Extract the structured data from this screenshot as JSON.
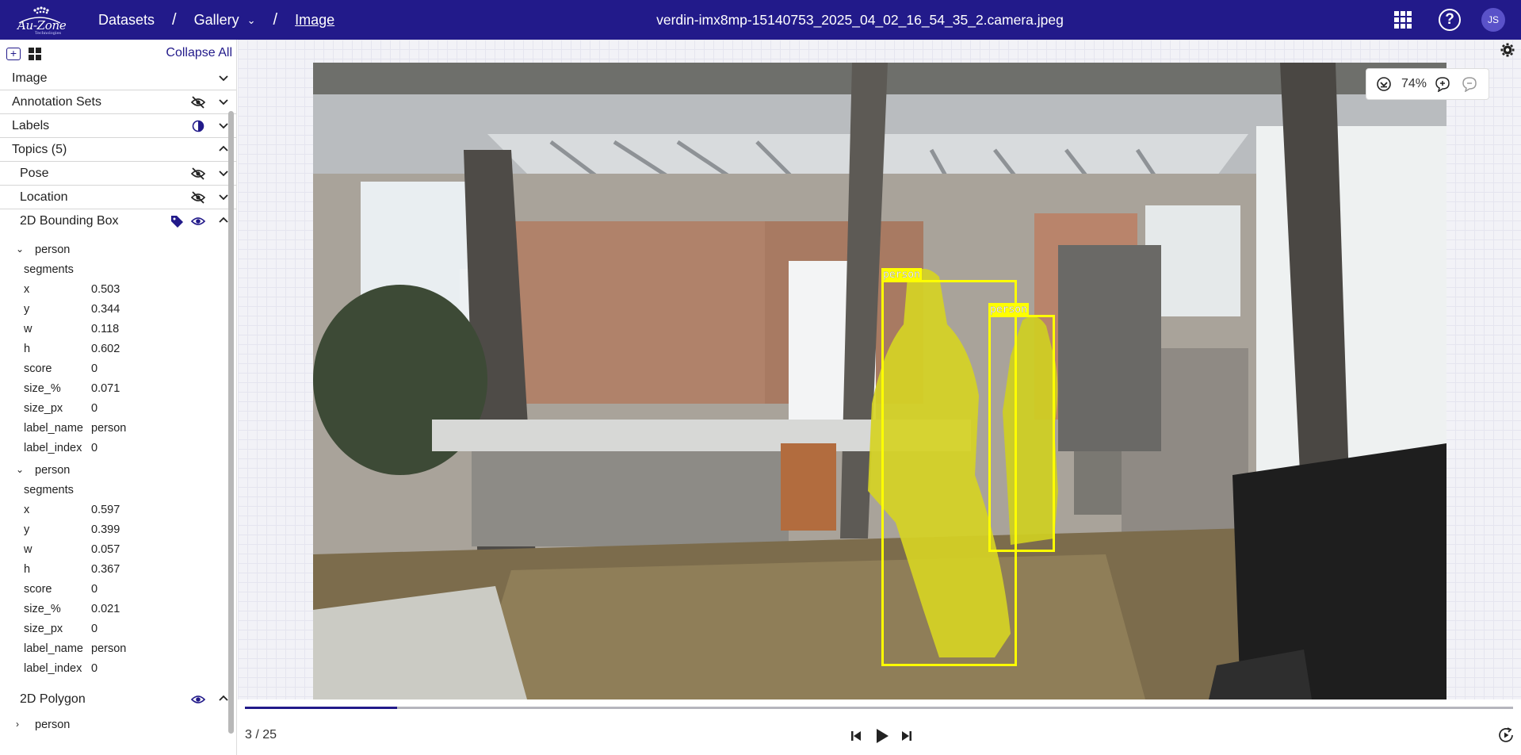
{
  "header": {
    "logo_text": "Au-Zone",
    "logo_sub": "Technologies",
    "crumbs": [
      "Datasets",
      "Gallery",
      "Image"
    ],
    "file_title": "verdin-imx8mp-15140753_2025_04_02_16_54_35_2.camera.jpeg",
    "avatar_initials": "JS",
    "brand_color": "#221a8a"
  },
  "sidebar": {
    "collapse_all": "Collapse All",
    "sections": {
      "image": "Image",
      "annotation_sets": "Annotation Sets",
      "labels": "Labels",
      "topics": "Topics (5)",
      "pose": "Pose",
      "location": "Location",
      "bbox2d": "2D Bounding Box",
      "polygon2d": "2D Polygon"
    },
    "bbox_items": [
      {
        "name": "person",
        "segments_label": "segments",
        "fields": [
          {
            "k": "x",
            "v": "0.503"
          },
          {
            "k": "y",
            "v": "0.344"
          },
          {
            "k": "w",
            "v": "0.118"
          },
          {
            "k": "h",
            "v": "0.602"
          },
          {
            "k": "score",
            "v": "0"
          },
          {
            "k": "size_%",
            "v": "0.071"
          },
          {
            "k": "size_px",
            "v": "0"
          },
          {
            "k": "label_name",
            "v": "person"
          },
          {
            "k": "label_index",
            "v": "0"
          }
        ]
      },
      {
        "name": "person",
        "segments_label": "segments",
        "fields": [
          {
            "k": "x",
            "v": "0.597"
          },
          {
            "k": "y",
            "v": "0.399"
          },
          {
            "k": "w",
            "v": "0.057"
          },
          {
            "k": "h",
            "v": "0.367"
          },
          {
            "k": "score",
            "v": "0"
          },
          {
            "k": "size_%",
            "v": "0.021"
          },
          {
            "k": "size_px",
            "v": "0"
          },
          {
            "k": "label_name",
            "v": "person"
          },
          {
            "k": "label_index",
            "v": "0"
          }
        ]
      }
    ],
    "polygon_items": [
      {
        "name": "person"
      }
    ]
  },
  "viewer": {
    "zoom": "74%",
    "overlay_boxes": [
      {
        "label": "person",
        "color": "#ffff00"
      },
      {
        "label": "person",
        "color": "#ffff00"
      }
    ]
  },
  "player": {
    "frame_text": "3 / 25",
    "current_frame": 3,
    "total_frames": 25
  }
}
